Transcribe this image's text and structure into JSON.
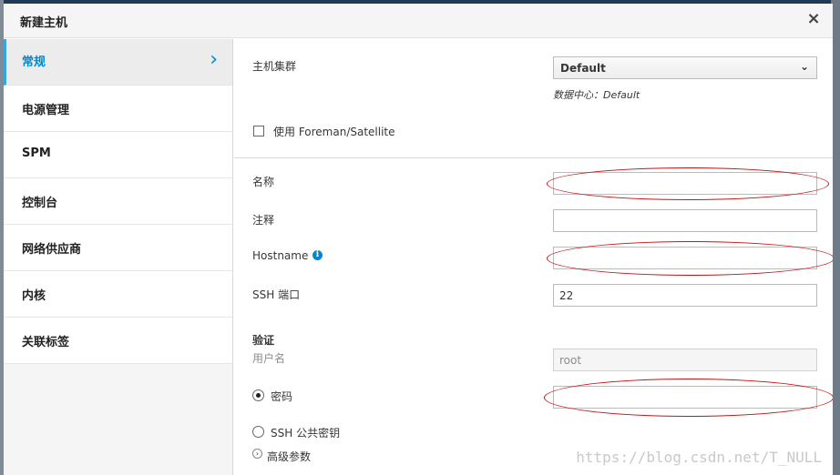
{
  "dialog": {
    "title": "新建主机",
    "close_label": "×"
  },
  "sidebar": {
    "items": [
      {
        "label": "常规",
        "active": true
      },
      {
        "label": "电源管理"
      },
      {
        "label": "SPM"
      },
      {
        "label": "控制台"
      },
      {
        "label": "网络供应商"
      },
      {
        "label": "内核"
      },
      {
        "label": "关联标签"
      }
    ],
    "active_chevron": "›"
  },
  "general": {
    "host_cluster_label": "主机集群",
    "host_cluster_value": "Default",
    "datacenter_hint": "数据中心：Default",
    "foreman_label": "使用 Foreman/Satellite",
    "name_label": "名称",
    "name_value": "",
    "comment_label": "注释",
    "comment_value": "",
    "hostname_label": "Hostname",
    "hostname_value": "",
    "ssh_port_label": "SSH 端口",
    "ssh_port_value": "22",
    "auth_heading": "验证",
    "username_label": "用户名",
    "username_value": "root",
    "password_label": "密码",
    "password_value": "",
    "ssh_key_label": "SSH 公共密钥",
    "advanced_label": "高级参数"
  },
  "annotations": {
    "highlight_color": "#c41414"
  },
  "watermark": "https://blog.csdn.net/T_NULL"
}
